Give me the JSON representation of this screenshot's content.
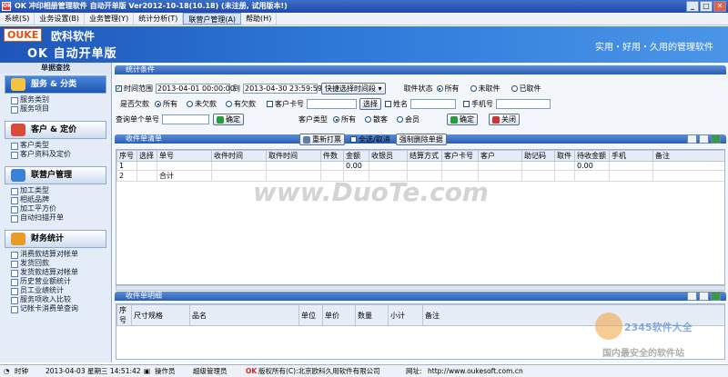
{
  "window": {
    "title": "OK 冲印相册管理软件 自动开单版 Ver2012-10-18(10.18) (未注册, 试用版本!)",
    "min": "_",
    "max": "□",
    "close": "✕"
  },
  "menu": [
    "系统(S)",
    "业务设置(B)",
    "业务管理(Y)",
    "统计分析(T)",
    "联营户管理(A)",
    "帮助(H)"
  ],
  "banner": {
    "logo_brand": "OUKE",
    "logo_name": "欧科软件",
    "logo_sub": "OK 自动开单版",
    "slogan": "实用・好用・久用的管理软件"
  },
  "sidebar": {
    "title": "单据查找",
    "groups": [
      {
        "label": "服务 & 分类",
        "items": [
          "服务类别",
          "服务项目"
        ]
      },
      {
        "label": "客户 & 定价",
        "items": [
          "客户类型",
          "客户资料及定价"
        ]
      },
      {
        "label": "联营户管理",
        "items": [
          "加工类型",
          "相纸品牌",
          "加工平方价",
          "自动扫描开单"
        ]
      },
      {
        "label": "财务统计",
        "items": [
          "消费款结算对帐单",
          "发货回款",
          "发货款结算对帐单",
          "历史营业额统计",
          "员工业绩统计",
          "服务项收入比较",
          "记帐卡消费单查询"
        ]
      }
    ]
  },
  "filter": {
    "section": "统计条件",
    "time_range_label": "时间范围",
    "date_from": "2013-04-01 00:00:00",
    "to_label": "到",
    "date_to": "2013-04-30 23:59:59",
    "quick_btn": "快捷选择时间段",
    "pickup_label": "取件状态",
    "pickup_opts": [
      "所有",
      "未取件",
      "已取件"
    ],
    "debt_label": "是否欠款",
    "debt_opts": [
      "所有",
      "未欠款",
      "有欠款"
    ],
    "customer_card_label": "客户卡号",
    "choose_btn": "选择",
    "name_label": "姓名",
    "phone_label": "手机号",
    "query_label": "查询单个单号",
    "confirm_btn": "确定",
    "customer_type_label": "客户类型",
    "ctype_opts": [
      "所有",
      "散客",
      "会员"
    ],
    "confirm_btn2": "确定",
    "close_btn": "关闭"
  },
  "orders": {
    "section": "收件单清单",
    "reprint_btn": "重新打票",
    "select_all": "全选/取消",
    "force_delete_btn": "强制删除单据",
    "columns": [
      "序号",
      "选择",
      "单号",
      "收件时间",
      "取件时间",
      "件数",
      "金额",
      "收银员",
      "结算方式",
      "客户卡号",
      "客户",
      "助记码",
      "取件",
      "待收金额",
      "手机",
      "备注"
    ],
    "rows": [
      {
        "no": "1",
        "total_label": "",
        "amount": "0.00",
        "pending": "0.00"
      },
      {
        "no": "2",
        "total_label": "合计",
        "amount": "",
        "pending": ""
      }
    ]
  },
  "details": {
    "section": "收件单明细",
    "columns": [
      "序号",
      "尺寸规格",
      "品名",
      "单位",
      "单价",
      "数量",
      "小计",
      "备注"
    ]
  },
  "status": {
    "time_label": "时钟",
    "datetime": "2013-04-03 星期三 14:51:42",
    "operator_label": "操作员",
    "operator": "超级管理员",
    "copyright": "版权所有(C):北京欧科久用软件有限公司",
    "site_label": "网址:",
    "site": "http://www.oukesoft.com.cn"
  },
  "watermark": {
    "text": "www.DuoTe.com",
    "site2345": "2345软件大全",
    "tagline": "国内最安全的软件站"
  }
}
